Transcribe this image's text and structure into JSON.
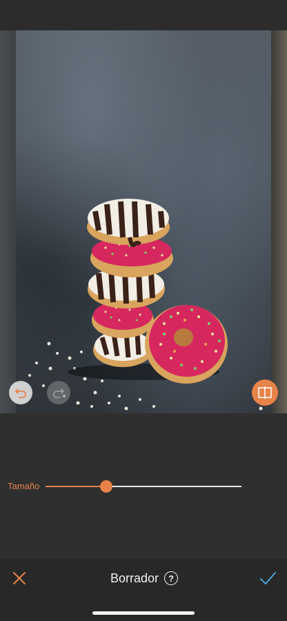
{
  "editor": {
    "tool_title": "Borrador",
    "help_symbol": "?",
    "size_label": "Tamaño",
    "size_value_percent": 33,
    "icons": {
      "undo": "undo-icon",
      "redo": "redo-icon",
      "compare": "compare-icon",
      "cancel": "close-icon",
      "confirm": "checkmark-icon"
    },
    "colors": {
      "accent": "#e8834a",
      "confirm": "#4aa3df",
      "background": "#2f2f2f"
    }
  }
}
